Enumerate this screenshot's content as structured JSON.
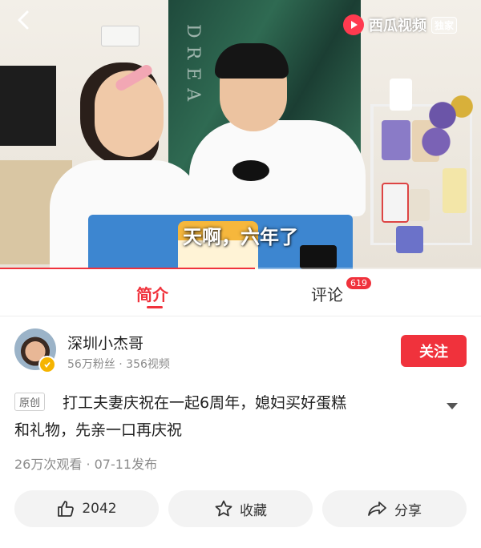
{
  "video": {
    "logo_text": "西瓜视频",
    "logo_badge": "独家",
    "subtitle": "天啊，六年了",
    "curtain_word": "DREA",
    "progress_fraction": 0.53,
    "accent_color": "#f0323c"
  },
  "tabs": {
    "intro_label": "简介",
    "comments_label": "评论",
    "comments_count": "619"
  },
  "author": {
    "name": "深圳小杰哥",
    "stats": "56万粉丝 · 356视频",
    "follow_label": "关注"
  },
  "post": {
    "original_badge": "原创",
    "title_line1": "打工夫妻庆祝在一起6周年，媳妇买好蛋糕",
    "title_line2": "和礼物，先亲一口再庆祝",
    "meta": "26万次观看 · 07-11发布"
  },
  "actions": {
    "like_count": "2042",
    "favorite_label": "收藏",
    "share_label": "分享"
  },
  "icons": [
    "back-icon",
    "xigua-logo-icon",
    "verified-icon",
    "expand-icon",
    "thumbs-up-icon",
    "star-icon",
    "share-icon"
  ]
}
